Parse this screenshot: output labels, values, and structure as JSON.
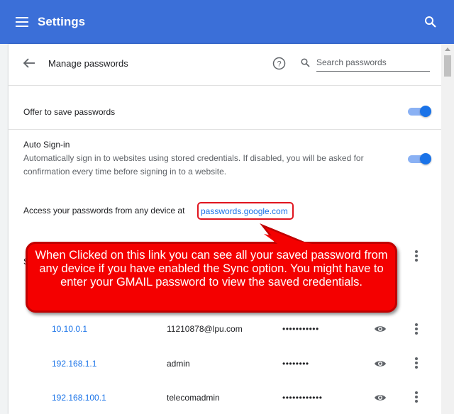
{
  "header": {
    "title": "Settings",
    "menu_icon": "hamburger-menu-icon",
    "search_icon": "search-icon"
  },
  "manage": {
    "back_icon": "back-arrow-icon",
    "title": "Manage passwords",
    "help_icon": "help-icon",
    "search_placeholder": "Search passwords"
  },
  "settings": {
    "offer_label": "Offer to save passwords",
    "offer_enabled": true,
    "autosignin_label": "Auto Sign-in",
    "autosignin_desc": "Automatically sign in to websites using stored credentials. If disabled, you will be asked for confirmation every time before signing in to a website.",
    "autosignin_enabled": true,
    "access_text": "Access your passwords from any device at",
    "access_link": "passwords.google.com"
  },
  "callout": {
    "text": "When Clicked on this link you can see all your saved password from any device if you have enabled the Sync option. You might have to enter your GMAIL password to view the saved credentials.",
    "color": "#f40000"
  },
  "partial_label": "S",
  "passwords": [
    {
      "site": "10.10.0.1",
      "user": "11210878@lpu.com",
      "pass": "•••••••••••"
    },
    {
      "site": "192.168.1.1",
      "user": "admin",
      "pass": "••••••••"
    },
    {
      "site": "192.168.100.1",
      "user": "telecomadmin",
      "pass": "••••••••••••"
    }
  ],
  "colors": {
    "header": "#3b6fd8",
    "accent": "#1a73e8",
    "callout_border": "#c00000"
  }
}
